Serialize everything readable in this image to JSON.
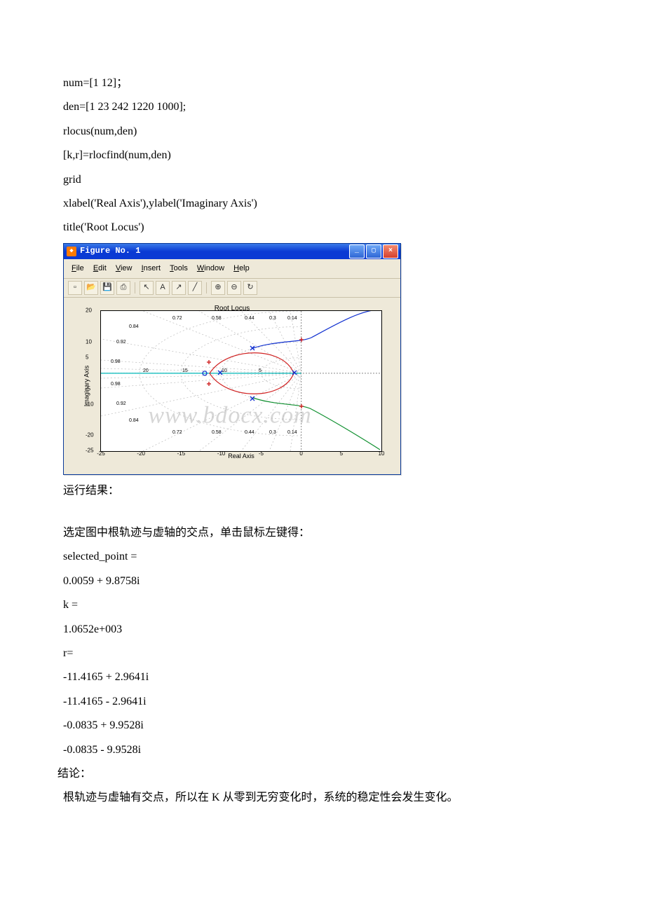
{
  "code": {
    "l1": "num=[1 12]；",
    "l2": "den=[1 23 242 1220 1000];",
    "l3": "rlocus(num,den)",
    "l4": "[k,r]=rlocfind(num,den)",
    "l5": "grid",
    "l6": "xlabel('Real Axis'),ylabel('Imaginary Axis')",
    "l7": "title('Root Locus')"
  },
  "figure": {
    "window_title": "Figure No. 1",
    "menus": {
      "file": "File",
      "edit": "Edit",
      "view": "View",
      "insert": "Insert",
      "tools": "Tools",
      "window": "Window",
      "help": "Help"
    },
    "plot_title": "Root Locus",
    "xlabel": "Real Axis",
    "ylabel": "Imaginary Axis",
    "xticks": [
      "-25",
      "-20",
      "-15",
      "-10",
      "-5",
      "0",
      "5",
      "10"
    ],
    "yticks": [
      "-25",
      "-20",
      "-10",
      "-5",
      "5",
      "10",
      "20"
    ],
    "damping_labels_top": [
      "0.72",
      "0.58",
      "0.44",
      "0.3",
      "0.14"
    ],
    "damping_labels_top2": [
      "0.84"
    ],
    "damping_labels_top3": [
      "0.92"
    ],
    "damping_labels_top4": [
      "0.98"
    ],
    "damping_labels_bot4": [
      "0.98"
    ],
    "damping_labels_bot3": [
      "0.92"
    ],
    "damping_labels_bot2": [
      "0.84"
    ],
    "damping_labels_bot": [
      "0.72",
      "0.58",
      "0.44",
      "0.3",
      "0.14"
    ],
    "freq_labels": [
      "20",
      "15",
      "10",
      "5"
    ]
  },
  "post": {
    "run_result": "运行结果：",
    "select_text": "选定图中根轨迹与虚轴的交点，单击鼠标左键得：",
    "sel_pt_label": "selected_point =",
    "sel_pt_val": "0.0059 + 9.8758i",
    "k_label": "k =",
    "k_val": "1.0652e+003",
    "r_label": "r=",
    "r1": "-11.4165 + 2.9641i",
    "r2": "-11.4165 - 2.9641i",
    "r3": "-0.0835 + 9.9528i",
    "r4": "-0.0835 - 9.9528i",
    "conclusion_label": "结论：",
    "conclusion_text": "根轨迹与虚轴有交点，所以在 K 从零到无穷变化时，系统的稳定性会发生变化。"
  },
  "watermark": "www.bdocx.com",
  "chart_data": {
    "type": "line",
    "title": "Root Locus",
    "xlabel": "Real Axis",
    "ylabel": "Imaginary Axis",
    "xlim": [
      -25,
      10
    ],
    "ylim": [
      -25,
      20
    ],
    "grid": true,
    "open_loop_zeros": [
      {
        "re": -12,
        "im": 0
      }
    ],
    "open_loop_poles_estimated": [
      {
        "re": -0.9,
        "im": 0
      },
      {
        "re": -10.1,
        "im": 0
      },
      {
        "re": -6.0,
        "im": 8.0
      },
      {
        "re": -6.0,
        "im": -8.0
      }
    ],
    "selected_point": {
      "re": 0.0059,
      "im": 9.8758
    },
    "selected_gain_k": 1065.2,
    "closed_loop_roots_at_k": [
      {
        "re": -11.4165,
        "im": 2.9641
      },
      {
        "re": -11.4165,
        "im": -2.9641
      },
      {
        "re": -0.0835,
        "im": 9.9528
      },
      {
        "re": -0.0835,
        "im": -9.9528
      }
    ],
    "root_locus_branches_estimated": [
      {
        "name": "upper-right",
        "path": [
          [
            -6,
            8
          ],
          [
            -3,
            9
          ],
          [
            0,
            9.9
          ],
          [
            5,
            14
          ],
          [
            9,
            19
          ]
        ]
      },
      {
        "name": "lower-right",
        "path": [
          [
            -6,
            -8
          ],
          [
            -3,
            -9
          ],
          [
            0,
            -9.9
          ],
          [
            5,
            -14
          ],
          [
            9,
            -19
          ]
        ]
      },
      {
        "name": "loop-upper",
        "path": [
          [
            -0.9,
            0
          ],
          [
            -6,
            8
          ],
          [
            -11,
            3
          ],
          [
            -12,
            0
          ]
        ]
      },
      {
        "name": "loop-lower",
        "path": [
          [
            -10.1,
            0
          ],
          [
            -11,
            -3
          ],
          [
            -6,
            -8
          ],
          [
            -0.9,
            0
          ]
        ]
      }
    ],
    "damping_rays": [
      0.14,
      0.3,
      0.44,
      0.58,
      0.72,
      0.84,
      0.92,
      0.98
    ],
    "natural_frequency_circles": [
      5,
      10,
      15,
      20
    ],
    "legend": null
  }
}
